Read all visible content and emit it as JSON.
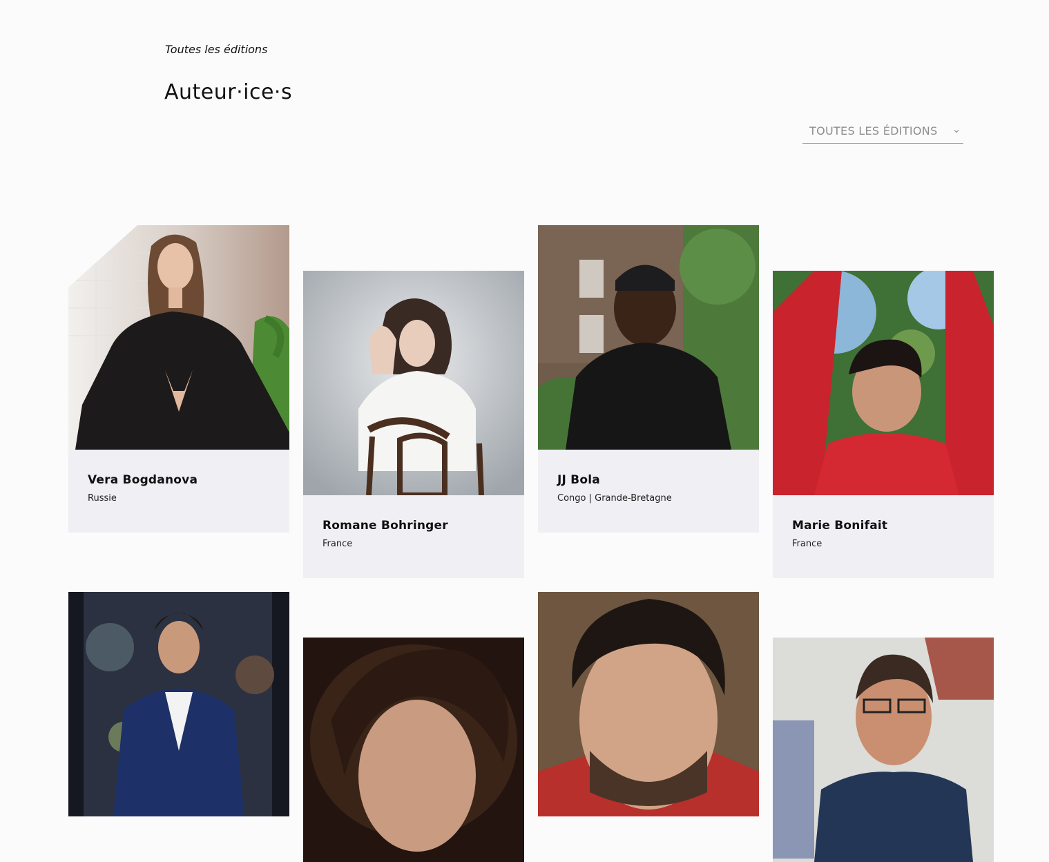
{
  "breadcrumb": "Toutes les éditions",
  "page_title": "Auteur·ice·s",
  "filter": {
    "selected": "TOUTES LES ÉDITIONS",
    "icon": "chevron-down-icon"
  },
  "authors": [
    {
      "name": "Vera Bogdanova",
      "country": "Russie"
    },
    {
      "name": "Romane Bohringer",
      "country": "France"
    },
    {
      "name": "JJ Bola",
      "country": "Congo | Grande-Bretagne"
    },
    {
      "name": "Marie Bonifait",
      "country": "France"
    }
  ],
  "colors": {
    "background": "#fbfbfc",
    "card_info_bg": "#efeff4",
    "select_text": "#8d8d8d",
    "text": "#111111"
  }
}
